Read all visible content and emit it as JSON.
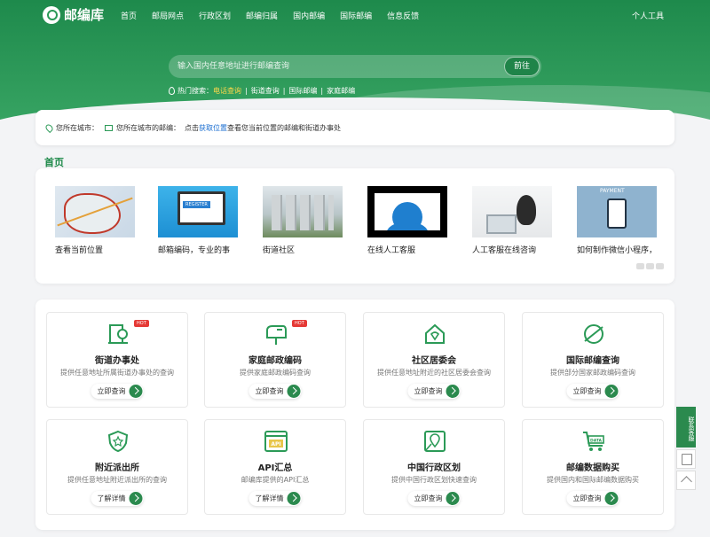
{
  "brand": {
    "logo_text": "邮编库"
  },
  "nav": {
    "items": [
      "首页",
      "邮局网点",
      "行政区划",
      "邮编归属",
      "国内邮编",
      "国际邮编",
      "信息反馈"
    ],
    "right": "个人工具"
  },
  "search": {
    "placeholder": "输入国内任意地址进行邮编查询",
    "button": "前往"
  },
  "hot_search": {
    "label": "热门搜索：",
    "items": [
      "电话查询",
      "街道查询",
      "国际邮编",
      "家庭邮编"
    ],
    "separator": "|"
  },
  "location_bar": {
    "city_label": "您所在城市：",
    "postcode_label": "您所在城市的邮编：",
    "hint_prefix": "点击",
    "hint_link": "获取位置",
    "hint_suffix": "查看您当前位置的邮编和街道办事处"
  },
  "home_section": {
    "title": "首页"
  },
  "carousel": {
    "slides": [
      {
        "caption": "查看当前位置",
        "image": "map-image"
      },
      {
        "caption": "邮箱编码，专业的事",
        "image": "register-image"
      },
      {
        "caption": "街道社区",
        "image": "city-image"
      },
      {
        "caption": "在线人工客服",
        "image": "customer-service-image"
      },
      {
        "caption": "人工客服在线咨询",
        "image": "laptop-girl-image"
      },
      {
        "caption": "如何制作微信小程序，",
        "image": "payment-image"
      }
    ]
  },
  "services": [
    {
      "title": "街道办事处",
      "desc": "提供任意地址所属街道办事处的查询",
      "button": "立即查询",
      "icon": "office-icon",
      "badge": "HOT"
    },
    {
      "title": "家庭邮政编码",
      "desc": "提供家庭邮政编码查询",
      "button": "立即查询",
      "icon": "mailbox-icon",
      "badge": "HOT"
    },
    {
      "title": "社区居委会",
      "desc": "提供任意地址附近的社区居委会查询",
      "button": "立即查询",
      "icon": "community-icon",
      "badge": ""
    },
    {
      "title": "国际邮编查询",
      "desc": "提供部分国家邮政编码查询",
      "button": "立即查询",
      "icon": "globe-icon",
      "badge": ""
    },
    {
      "title": "附近派出所",
      "desc": "提供任意地址附近派出所的查询",
      "button": "了解详情",
      "icon": "police-icon",
      "badge": ""
    },
    {
      "title": "API汇总",
      "desc": "邮编库提供的API汇总",
      "button": "了解详情",
      "icon": "api-icon",
      "badge": ""
    },
    {
      "title": "中国行政区划",
      "desc": "提供中国行政区划快速查询",
      "button": "立即查询",
      "icon": "map-pin-icon",
      "badge": ""
    },
    {
      "title": "邮编数据购买",
      "desc": "提供国内和国际邮编数据购买",
      "button": "立即查询",
      "icon": "cart-icon",
      "badge": ""
    }
  ],
  "sidebar": {
    "contact": "联系客服"
  },
  "colors": {
    "primary": "#2b9a57",
    "dark": "#1f8449",
    "link": "#1c6fd1",
    "highlight": "#ffd84a"
  }
}
